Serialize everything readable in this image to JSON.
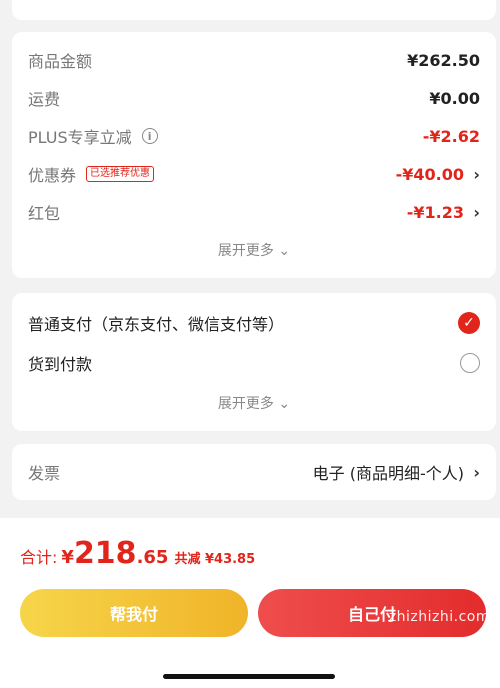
{
  "summary": {
    "rows": [
      {
        "label": "商品金额",
        "value": "¥262.50"
      },
      {
        "label": "运费",
        "value": "¥0.00"
      },
      {
        "label": "PLUS专享立减",
        "value": "-¥2.62"
      },
      {
        "label": "优惠券",
        "tag": "已选推荐优惠",
        "value": "-¥40.00"
      },
      {
        "label": "红包",
        "value": "-¥1.23"
      }
    ],
    "more": "展开更多"
  },
  "payment": {
    "options": [
      {
        "label": "普通支付（京东支付、微信支付等）",
        "selected": true
      },
      {
        "label": "货到付款",
        "selected": false
      }
    ],
    "more": "展开更多"
  },
  "invoice": {
    "label": "发票",
    "value": "电子 (商品明细-个人)"
  },
  "footer": {
    "total_label": "合计:",
    "currency": "¥",
    "total_int": "218",
    "total_dec": ".65",
    "savings": "共减 ¥43.85",
    "btn_help_pay": "帮我付",
    "btn_self_pay": "自己付",
    "watermark": "zhizhizhi.com"
  },
  "colors": {
    "accent": "#e1251b",
    "help_pay_gradient": [
      "#f6d54a",
      "#f0b429"
    ],
    "self_pay_gradient": [
      "#ef4d4d",
      "#e32c2c"
    ]
  }
}
